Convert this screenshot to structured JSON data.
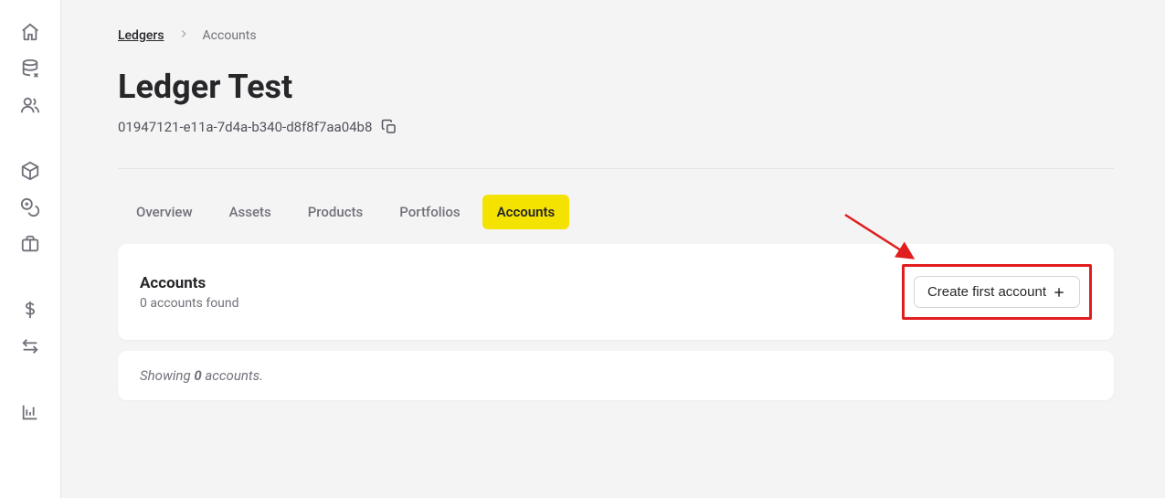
{
  "breadcrumb": {
    "parent": "Ledgers",
    "current": "Accounts"
  },
  "page": {
    "title": "Ledger Test",
    "id": "01947121-e11a-7d4a-b340-d8f8f7aa04b8"
  },
  "tabs": [
    {
      "label": "Overview",
      "active": false
    },
    {
      "label": "Assets",
      "active": false
    },
    {
      "label": "Products",
      "active": false
    },
    {
      "label": "Portfolios",
      "active": false
    },
    {
      "label": "Accounts",
      "active": true
    }
  ],
  "panel": {
    "title": "Accounts",
    "subtitle": "0 accounts found",
    "create_label": "Create first account"
  },
  "status": {
    "prefix": "Showing ",
    "count": "0",
    "suffix": " accounts."
  }
}
